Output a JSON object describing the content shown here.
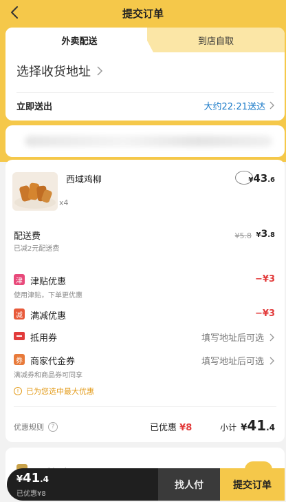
{
  "header": {
    "title": "提交订单"
  },
  "tabs": {
    "delivery": "外卖配送",
    "pickup": "到店自取"
  },
  "address": {
    "label": "选择收货地址"
  },
  "delivery_time": {
    "label": "立即送出",
    "estimate": "大约22:21送达"
  },
  "item": {
    "name": "西域鸡柳",
    "quantity": "x4",
    "price_symbol": "¥",
    "price_int": "43",
    "price_dec": ".6"
  },
  "delivery_fee": {
    "label": "配送费",
    "note": "已减2元配送费",
    "original": "¥5.8",
    "price_symbol": "¥",
    "price_int": "3",
    "price_dec": ".8"
  },
  "discounts": [
    {
      "badge": "津",
      "label": "津贴优惠",
      "note": "使用津贴，下单更优惠",
      "value": "−¥3"
    },
    {
      "badge": "减",
      "label": "满减优惠",
      "note": "",
      "value": "−¥3"
    }
  ],
  "vouchers": [
    {
      "label": "抵用券",
      "hint": "填写地址后可选",
      "note": ""
    },
    {
      "badge": "券",
      "label": "商家代金券",
      "hint": "填写地址后可选",
      "note": "满减券和商品券可同享"
    }
  ],
  "max_discount_note": "已为您选中最大优惠",
  "summary": {
    "rules_label": "优惠规则",
    "saved_label": "已优惠",
    "saved_amount": "¥8",
    "subtotal_label": "小计",
    "subtotal_symbol": "¥",
    "subtotal_int": "41",
    "subtotal_dec": ".4"
  },
  "guarantee": {
    "label": "品质保障"
  },
  "bottom_bar": {
    "total_symbol": "¥",
    "total_int": "41",
    "total_dec": ".4",
    "saved_note": "已优惠¥8",
    "find_payer": "找人付",
    "submit": "提交订单"
  },
  "colors": {
    "accent": "#f5c84a",
    "discount_red": "#e23b3b",
    "link_blue": "#1a7ac8",
    "warning": "#e39b19"
  }
}
